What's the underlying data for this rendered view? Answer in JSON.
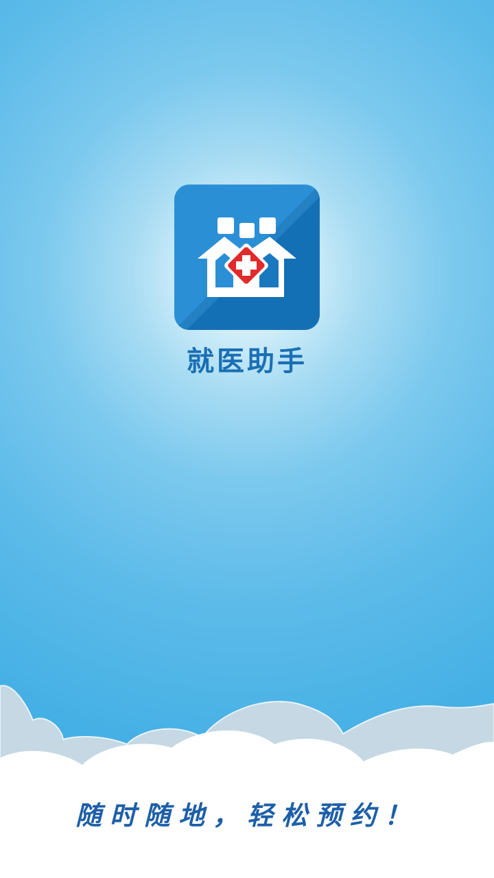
{
  "splash": {
    "app_name": "就医助手",
    "slogan": "随时随地，轻松预约！"
  },
  "icons": {
    "logo": "hospital-house-family-icon"
  },
  "colors": {
    "icon_blue": "#2b8fd6",
    "icon_blue_dark": "#1470b5",
    "title_blue": "#1a6fb4",
    "slogan_blue": "#1d5fa8",
    "cross_red": "#e12a2a",
    "sky_edge": "#3aa9e2"
  }
}
